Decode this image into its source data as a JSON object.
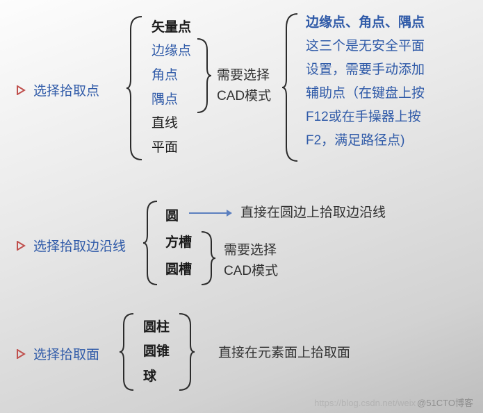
{
  "colors": {
    "accent": "#2f5aa8",
    "accent_arrow": "#c0504d",
    "text": "#1a1a1a",
    "brace": "#2b2b2b"
  },
  "section1": {
    "title": "选择拾取点",
    "items": [
      {
        "label": "矢量点",
        "style": "blk"
      },
      {
        "label": "边缘点",
        "style": "nav"
      },
      {
        "label": "角点",
        "style": "nav"
      },
      {
        "label": "隅点",
        "style": "nav"
      },
      {
        "label": "直线",
        "style": "blk2"
      },
      {
        "label": "平面",
        "style": "blk2"
      }
    ],
    "mid_note": {
      "line1": "需要选择",
      "line2": "CAD模式"
    },
    "right_note": {
      "line1": "边缘点、角点、隅点",
      "line2": "这三个是无安全平面",
      "line3": "设置，需要手动添加",
      "line4": "辅助点（在键盘上按",
      "line5": "F12或在手操器上按",
      "line6": "F2，满足路径点)"
    }
  },
  "section2": {
    "title": "选择拾取边沿线",
    "items": [
      {
        "label": "圆",
        "style": "blk"
      },
      {
        "label": "方槽",
        "style": "blk"
      },
      {
        "label": "圆槽",
        "style": "blk"
      }
    ],
    "top_note": "直接在圆边上拾取边沿线",
    "mid_note": {
      "line1": "需要选择",
      "line2": "CAD模式"
    }
  },
  "section3": {
    "title": "选择拾取面",
    "items": [
      {
        "label": "圆柱",
        "style": "blk"
      },
      {
        "label": "圆锥",
        "style": "blk"
      },
      {
        "label": "球",
        "style": "blk"
      }
    ],
    "note": "直接在元素面上拾取面"
  },
  "watermark": {
    "faint": "https://blog.csdn.net/weix",
    "label": "@51CTO博客"
  }
}
